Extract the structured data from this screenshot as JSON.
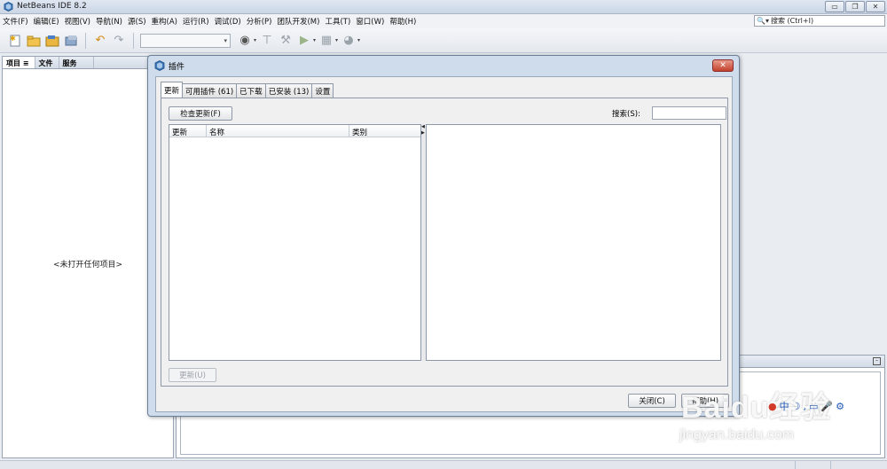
{
  "window": {
    "title": "NetBeans IDE 8.2",
    "controls": [
      "minimize-icon",
      "restore-icon",
      "close-icon"
    ]
  },
  "menubar": {
    "items": [
      "文件(F)",
      "编辑(E)",
      "视图(V)",
      "导航(N)",
      "源(S)",
      "重构(A)",
      "运行(R)",
      "调试(D)",
      "分析(P)",
      "团队开发(M)",
      "工具(T)",
      "窗口(W)",
      "帮助(H)"
    ]
  },
  "quick_search": {
    "icon": "search-icon",
    "placeholder": "搜索 (Ctrl+I)"
  },
  "toolbar": {
    "icons": [
      "new-file-icon",
      "new-project-icon",
      "open-project-icon",
      "close-project-icon",
      "undo-icon",
      "redo-icon",
      "build-icon",
      "clean-build-icon",
      "run-icon",
      "debug-icon",
      "profile-icon"
    ]
  },
  "projects_panel": {
    "tabs": [
      "项目",
      "文件",
      "服务"
    ],
    "active_tab": "项目",
    "empty_text": "<未打开任何项目>"
  },
  "plugins_dialog": {
    "title": "插件",
    "tabs": [
      "更新",
      "可用插件 (61)",
      "已下载",
      "已安装 (13)",
      "设置"
    ],
    "active_tab": "更新",
    "check_updates_button": "检查更新(F)",
    "search_label": "搜索(S):",
    "search_value": "",
    "table_columns": [
      "更新",
      "名称",
      "类别"
    ],
    "table_rows": [],
    "update_button": "更新(U)",
    "close_button": "关闭(C)",
    "help_button": "帮助(H)"
  },
  "watermark": {
    "logo": "Baidu经验",
    "url": "jingyan.baidu.com"
  },
  "colors": {
    "dialog_frame": "#cfdcec",
    "close_button": "#c2412c",
    "panel_background": "#f0f0f0"
  }
}
